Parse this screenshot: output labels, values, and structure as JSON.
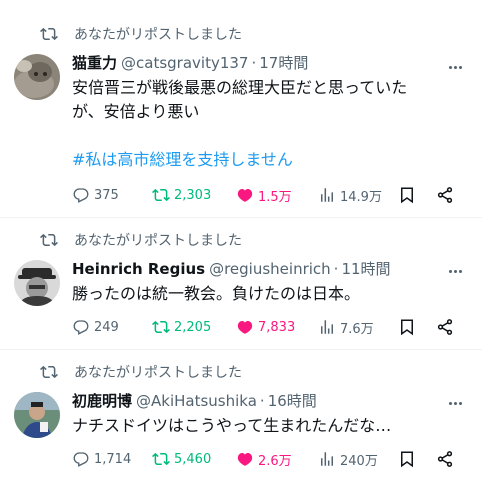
{
  "tweets": [
    {
      "repost_label": "あなたがリポストしました",
      "name": "猫重力",
      "handle": "@catsgravity137",
      "time": "17時間",
      "body_lines": [
        "安倍晋三が戦後最悪の総理大臣だと思っていた",
        "が、安倍より悪い"
      ],
      "hashtag": "#私は高市総理を支持しません",
      "replies": "375",
      "reposts": "2,303",
      "likes": "1.5万",
      "views": "14.9万"
    },
    {
      "repost_label": "あなたがリポストしました",
      "name": "Heinrich Regius",
      "handle": "@regiusheinrich",
      "time": "11時間",
      "body_lines": [
        "勝ったのは統一教会。負けたのは日本。"
      ],
      "replies": "249",
      "reposts": "2,205",
      "likes": "7,833",
      "views": "7.6万"
    },
    {
      "repost_label": "あなたがリポストしました",
      "name": "初鹿明博",
      "handle": "@AkiHatsushika",
      "time": "16時間",
      "body_lines": [
        "ナチスドイツはこうやって生まれたんだな…"
      ],
      "replies": "1,714",
      "reposts": "5,460",
      "likes": "2.6万",
      "views": "240万"
    }
  ],
  "colors": {
    "accent": "#1d9bf0",
    "repost": "#00ba7c",
    "like": "#f91880",
    "muted": "#536471"
  },
  "icons": [
    "repost-icon",
    "reply-icon",
    "like-icon",
    "views-icon",
    "bookmark-icon",
    "share-icon",
    "more-icon"
  ]
}
